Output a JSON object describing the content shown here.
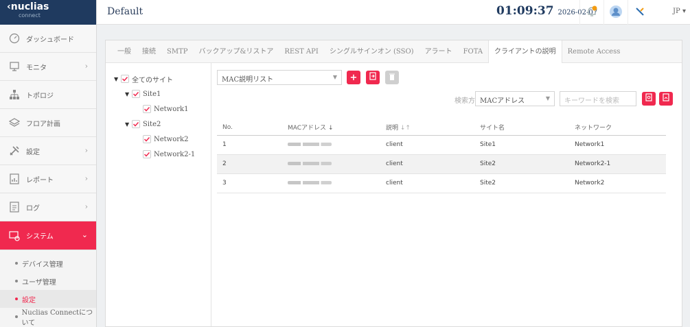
{
  "sidebar": {
    "logo": {
      "brand": "nuclias",
      "sub": "connect"
    },
    "items": [
      {
        "label": "ダッシュボード",
        "icon": "dashboard-icon",
        "has_children": false
      },
      {
        "label": "モニタ",
        "icon": "monitor-icon",
        "has_children": true
      },
      {
        "label": "トポロジ",
        "icon": "topology-icon",
        "has_children": false
      },
      {
        "label": "フロア計画",
        "icon": "floor-plan-icon",
        "has_children": false
      },
      {
        "label": "設定",
        "icon": "settings-icon",
        "has_children": true
      },
      {
        "label": "レポート",
        "icon": "report-icon",
        "has_children": true
      },
      {
        "label": "ログ",
        "icon": "log-icon",
        "has_children": true
      },
      {
        "label": "システム",
        "icon": "system-icon",
        "has_children": true,
        "active": true
      }
    ],
    "sub_items": [
      {
        "label": "デバイス管理"
      },
      {
        "label": "ユーザ管理"
      },
      {
        "label": "設定",
        "active": true
      },
      {
        "label": "Nuclias Connectについて"
      }
    ]
  },
  "header": {
    "title": "Default",
    "time": "01:09:37",
    "date": "2026-02-07",
    "language": "JP"
  },
  "tabs": [
    {
      "label": "一般"
    },
    {
      "label": "接続"
    },
    {
      "label": "SMTP"
    },
    {
      "label": "バックアップ&リストア"
    },
    {
      "label": "REST API"
    },
    {
      "label": "シングルサインオン (SSO)"
    },
    {
      "label": "アラート"
    },
    {
      "label": "FOTA"
    },
    {
      "label": "クライアントの説明",
      "active": true
    },
    {
      "label": "Remote Access"
    }
  ],
  "tree": {
    "root": "全てのサイト",
    "site1": "Site1",
    "site1_net1": "Network1",
    "site2": "Site2",
    "site2_net1": "Network2",
    "site2_net2": "Network2-1"
  },
  "toolbar": {
    "list_select": "MAC説明リスト",
    "search_method_label": "検索方法",
    "search_method_value": "MACアドレス",
    "search_placeholder": "キーワードを検索"
  },
  "table": {
    "headers": {
      "no": "No.",
      "mac": "MACアドレス",
      "desc": "説明",
      "site": "サイト名",
      "network": "ネットワーク"
    },
    "rows": [
      {
        "no": "1",
        "desc": "client",
        "site": "Site1",
        "network": "Network1"
      },
      {
        "no": "2",
        "desc": "client",
        "site": "Site2",
        "network": "Network2-1"
      },
      {
        "no": "3",
        "desc": "client",
        "site": "Site2",
        "network": "Network2"
      }
    ]
  },
  "colors": {
    "accent": "#f0294f",
    "brand_dark": "#1f3a5f"
  }
}
